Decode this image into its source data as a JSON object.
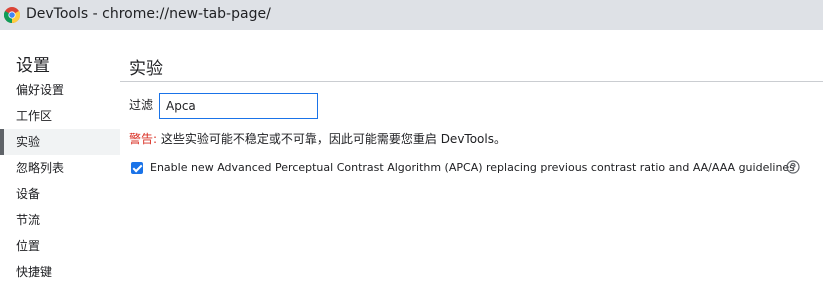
{
  "window": {
    "title": "DevTools - chrome://new-tab-page/"
  },
  "icons": {
    "browser": "chrome-logo-icon",
    "help": "help-circle-icon",
    "checkbox": "checkmark-icon"
  },
  "colors": {
    "accent": "#1a73e8",
    "warning": "#d93025",
    "selected_bar": "#5f6368",
    "titlebar": "#dee1e6"
  },
  "sidebar": {
    "title": "设置",
    "items": [
      {
        "label": "偏好设置",
        "selected": false
      },
      {
        "label": "工作区",
        "selected": false
      },
      {
        "label": "实验",
        "selected": true
      },
      {
        "label": "忽略列表",
        "selected": false
      },
      {
        "label": "设备",
        "selected": false
      },
      {
        "label": "节流",
        "selected": false
      },
      {
        "label": "位置",
        "selected": false
      },
      {
        "label": "快捷键",
        "selected": false
      }
    ]
  },
  "main": {
    "title": "实验",
    "filter": {
      "label": "过滤",
      "value": "Apca"
    },
    "warning": {
      "label": "警告:",
      "text": "这些实验可能不稳定或不可靠，因此可能需要您重启 DevTools。"
    },
    "experiments": [
      {
        "label": "Enable new Advanced Perceptual Contrast Algorithm (APCA) replacing previous contrast ratio and AA/AAA guidelines",
        "checked": true
      }
    ]
  }
}
